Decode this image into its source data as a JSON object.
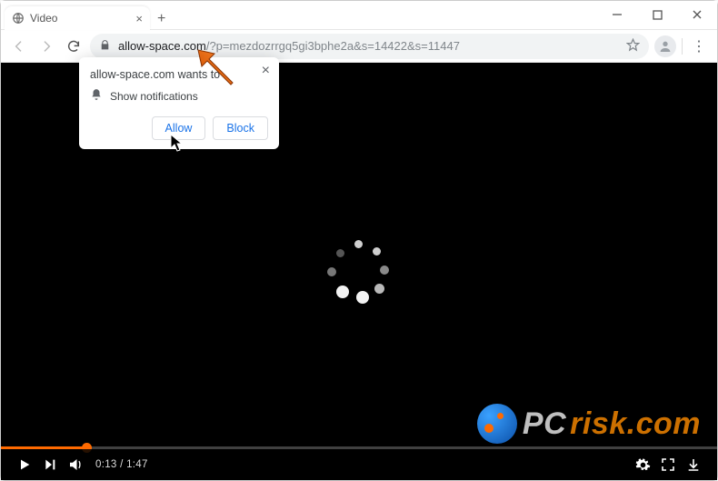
{
  "window": {
    "tab_title": "Video",
    "new_tab_glyph": "+"
  },
  "toolbar": {
    "url_host": "allow-space.com",
    "url_path": "/?p=mezdozrrgq5gi3bphe2a&s=14422&s=11447"
  },
  "notification": {
    "heading": "allow-space.com wants to",
    "line": "Show notifications",
    "allow_label": "Allow",
    "block_label": "Block"
  },
  "player": {
    "current_time": "0:13",
    "duration": "1:47",
    "time_sep": " / ",
    "progress_percent": 12
  },
  "watermark": {
    "part1": "PC",
    "part2": "risk.com"
  }
}
